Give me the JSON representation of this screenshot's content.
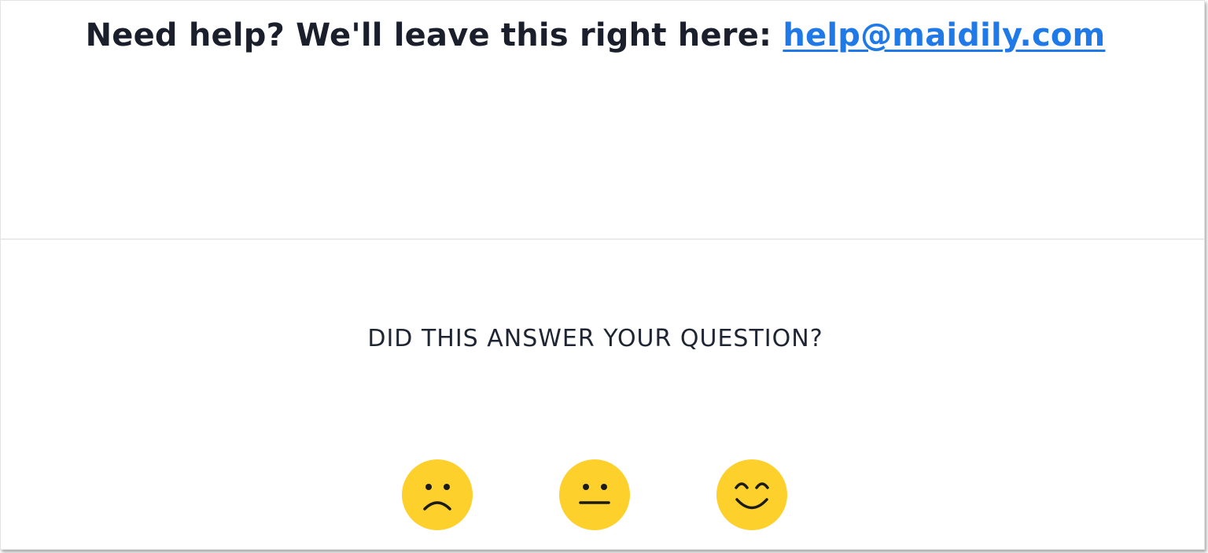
{
  "help": {
    "prefix": "Need help? We'll leave this right here: ",
    "email": "help@maidily.com"
  },
  "feedback": {
    "question": "DID THIS ANSWER YOUR QUESTION?",
    "reactions": [
      {
        "name": "sad",
        "icon": "frowning-face-icon"
      },
      {
        "name": "neutral",
        "icon": "neutral-face-icon"
      },
      {
        "name": "happy",
        "icon": "smiling-face-icon"
      }
    ]
  },
  "colors": {
    "link": "#1f7ae8",
    "text": "#1a1f2b",
    "emoji": "#fdd02b"
  }
}
